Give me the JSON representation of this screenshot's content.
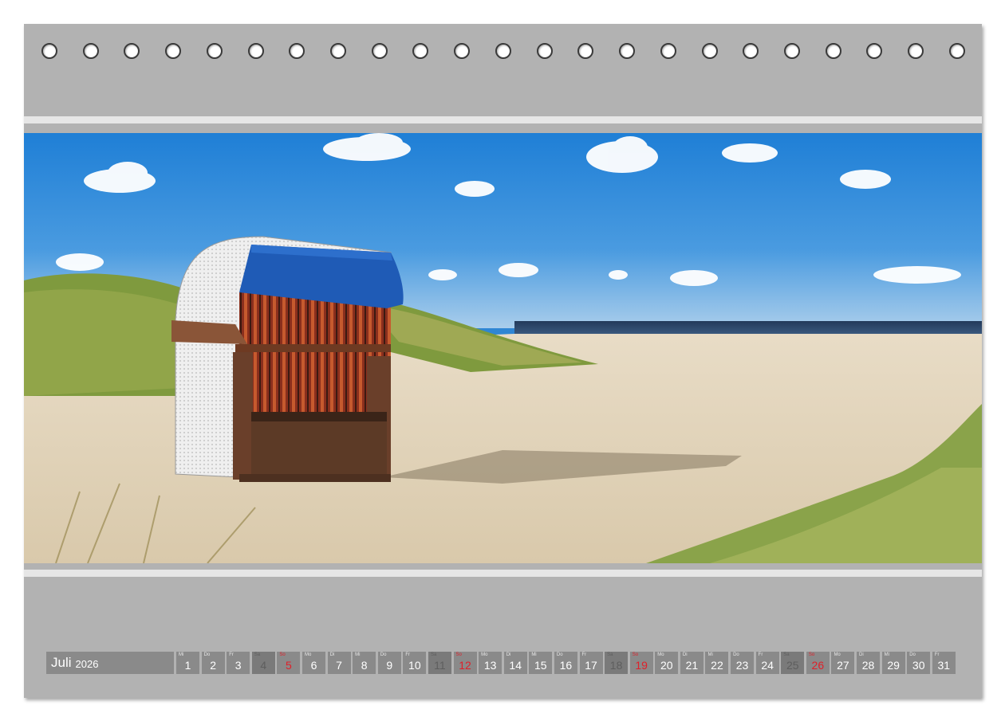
{
  "calendar": {
    "month": "Juli",
    "year": "2026",
    "days": [
      {
        "wd": "Mi",
        "n": "1",
        "type": "weekday"
      },
      {
        "wd": "Do",
        "n": "2",
        "type": "weekday"
      },
      {
        "wd": "Fr",
        "n": "3",
        "type": "weekday"
      },
      {
        "wd": "Sa",
        "n": "4",
        "type": "sat"
      },
      {
        "wd": "So",
        "n": "5",
        "type": "sun"
      },
      {
        "wd": "Mo",
        "n": "6",
        "type": "weekday"
      },
      {
        "wd": "Di",
        "n": "7",
        "type": "weekday"
      },
      {
        "wd": "Mi",
        "n": "8",
        "type": "weekday"
      },
      {
        "wd": "Do",
        "n": "9",
        "type": "weekday"
      },
      {
        "wd": "Fr",
        "n": "10",
        "type": "weekday"
      },
      {
        "wd": "Sa",
        "n": "11",
        "type": "sat"
      },
      {
        "wd": "So",
        "n": "12",
        "type": "sun"
      },
      {
        "wd": "Mo",
        "n": "13",
        "type": "weekday"
      },
      {
        "wd": "Di",
        "n": "14",
        "type": "weekday"
      },
      {
        "wd": "Mi",
        "n": "15",
        "type": "weekday"
      },
      {
        "wd": "Do",
        "n": "16",
        "type": "weekday"
      },
      {
        "wd": "Fr",
        "n": "17",
        "type": "weekday"
      },
      {
        "wd": "Sa",
        "n": "18",
        "type": "sat"
      },
      {
        "wd": "So",
        "n": "19",
        "type": "sun"
      },
      {
        "wd": "Mo",
        "n": "20",
        "type": "weekday"
      },
      {
        "wd": "Di",
        "n": "21",
        "type": "weekday"
      },
      {
        "wd": "Mi",
        "n": "22",
        "type": "weekday"
      },
      {
        "wd": "Do",
        "n": "23",
        "type": "weekday"
      },
      {
        "wd": "Fr",
        "n": "24",
        "type": "weekday"
      },
      {
        "wd": "Sa",
        "n": "25",
        "type": "sat"
      },
      {
        "wd": "So",
        "n": "26",
        "type": "sun"
      },
      {
        "wd": "Mo",
        "n": "27",
        "type": "weekday"
      },
      {
        "wd": "Di",
        "n": "28",
        "type": "weekday"
      },
      {
        "wd": "Mi",
        "n": "29",
        "type": "weekday"
      },
      {
        "wd": "Do",
        "n": "30",
        "type": "weekday"
      },
      {
        "wd": "Fr",
        "n": "31",
        "type": "weekday"
      }
    ]
  },
  "binding": {
    "hole_count": 23
  },
  "photo": {
    "icon": "beach-chair-photo"
  },
  "colors": {
    "frame": "#b2b2b2",
    "day_cell": "#8a8a8a",
    "saturday_cell": "#7a7a7a",
    "sunday_text": "#e0202a"
  }
}
